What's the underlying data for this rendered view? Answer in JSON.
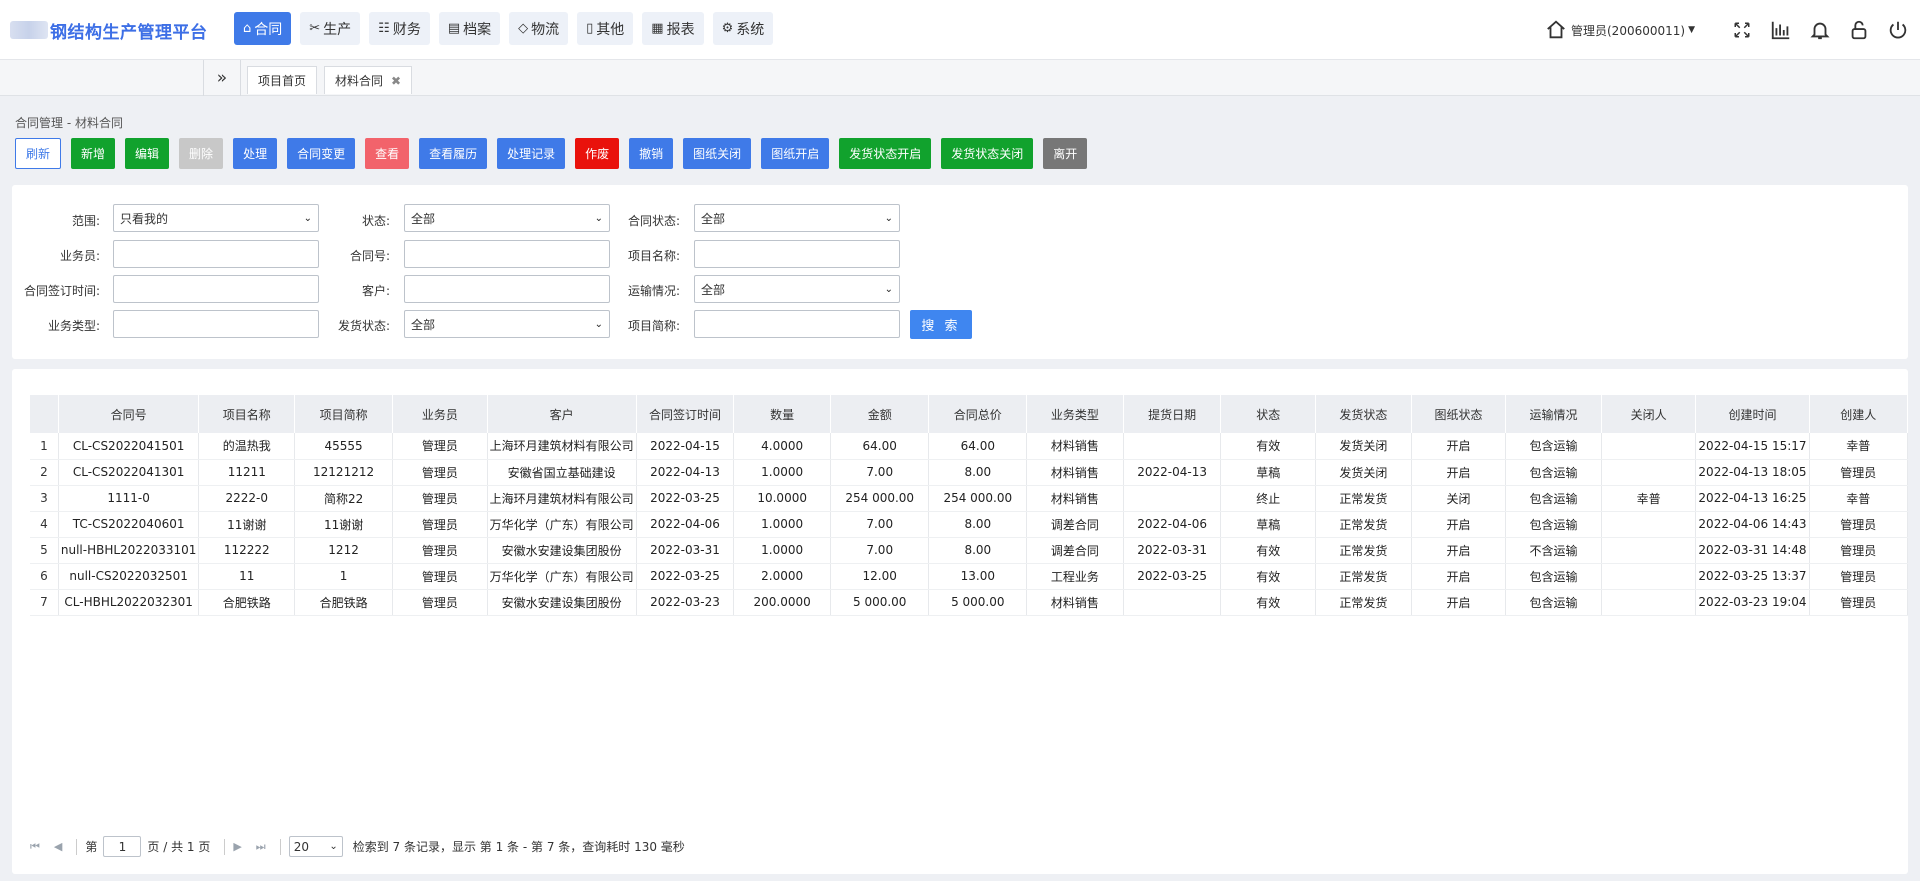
{
  "header": {
    "app_title": "钢结构生产管理平台",
    "nav": [
      {
        "label": "合同",
        "icon": "home-icon",
        "active": true
      },
      {
        "label": "生产",
        "icon": "scissors-icon",
        "active": false
      },
      {
        "label": "财务",
        "icon": "list-check-icon",
        "active": false
      },
      {
        "label": "档案",
        "icon": "archive-icon",
        "active": false
      },
      {
        "label": "物流",
        "icon": "tag-icon",
        "active": false
      },
      {
        "label": "其他",
        "icon": "document-icon",
        "active": false
      },
      {
        "label": "报表",
        "icon": "grid-icon",
        "active": false
      },
      {
        "label": "系统",
        "icon": "gear-icon",
        "active": false
      }
    ],
    "user": "管理员(200600011)"
  },
  "tabs": {
    "items": [
      {
        "label": "项目首页",
        "closable": false
      },
      {
        "label": "材料合同",
        "closable": true
      }
    ]
  },
  "breadcrumb": "合同管理 - 材料合同",
  "toolbar": {
    "refresh": "刷新",
    "add": "新增",
    "edit": "编辑",
    "delete": "删除",
    "process": "处理",
    "change": "合同变更",
    "view": "查看",
    "view_history": "查看履历",
    "process_log": "处理记录",
    "void": "作废",
    "revoke": "撤销",
    "drawing_close": "图纸关闭",
    "drawing_open": "图纸开启",
    "ship_open": "发货状态开启",
    "ship_close": "发货状态关闭",
    "leave": "离开"
  },
  "filters": {
    "scope_label": "范围:",
    "scope_value": "只看我的",
    "status_label": "状态:",
    "status_value": "全部",
    "contract_status_label": "合同状态:",
    "contract_status_value": "全部",
    "salesman_label": "业务员:",
    "salesman_value": "",
    "contract_no_label": "合同号:",
    "contract_no_value": "",
    "project_name_label": "项目名称:",
    "project_name_value": "",
    "sign_time_label": "合同签订时间:",
    "sign_time_value": "",
    "customer_label": "客户:",
    "customer_value": "",
    "transport_label": "运输情况:",
    "transport_value": "全部",
    "biz_type_label": "业务类型:",
    "biz_type_value": "",
    "ship_status_label": "发货状态:",
    "ship_status_value": "全部",
    "project_short_label": "项目简称:",
    "project_short_value": "",
    "search_button": "搜 索"
  },
  "grid": {
    "columns": [
      "合同号",
      "项目名称",
      "项目简称",
      "业务员",
      "客户",
      "合同签订时间",
      "数量",
      "金额",
      "合同总价",
      "业务类型",
      "提货日期",
      "状态",
      "发货状态",
      "图纸状态",
      "运输情况",
      "关闭人",
      "创建时间",
      "创建人"
    ],
    "rows": [
      [
        "1",
        "CL-CS2022041501",
        "的温热我",
        "45555",
        "管理员",
        "上海环月建筑材料有限公司",
        "2022-04-15",
        "4.0000",
        "64.00",
        "64.00",
        "材料销售",
        "",
        "有效",
        "发货关闭",
        "开启",
        "包含运输",
        "",
        "2022-04-15 15:17",
        "幸普"
      ],
      [
        "2",
        "CL-CS2022041301",
        "11211",
        "12121212",
        "管理员",
        "安徽省国立基础建设",
        "2022-04-13",
        "1.0000",
        "7.00",
        "8.00",
        "材料销售",
        "2022-04-13",
        "草稿",
        "发货关闭",
        "开启",
        "包含运输",
        "",
        "2022-04-13 18:05",
        "管理员"
      ],
      [
        "3",
        "1111-0",
        "2222-0",
        "简称22",
        "管理员",
        "上海环月建筑材料有限公司",
        "2022-03-25",
        "10.0000",
        "254 000.00",
        "254 000.00",
        "材料销售",
        "",
        "终止",
        "正常发货",
        "关闭",
        "包含运输",
        "幸普",
        "2022-04-13 16:25",
        "幸普"
      ],
      [
        "4",
        "TC-CS2022040601",
        "11谢谢",
        "11谢谢",
        "管理员",
        "万华化学（广东）有限公司",
        "2022-04-06",
        "1.0000",
        "7.00",
        "8.00",
        "调差合同",
        "2022-04-06",
        "草稿",
        "正常发货",
        "开启",
        "包含运输",
        "",
        "2022-04-06 14:43",
        "管理员"
      ],
      [
        "5",
        "null-HBHL2022033101",
        "112222",
        "1212",
        "管理员",
        "安徽水安建设集团股份",
        "2022-03-31",
        "1.0000",
        "7.00",
        "8.00",
        "调差合同",
        "2022-03-31",
        "有效",
        "正常发货",
        "开启",
        "不含运输",
        "",
        "2022-03-31 14:48",
        "管理员"
      ],
      [
        "6",
        "null-CS2022032501",
        "11",
        "1",
        "管理员",
        "万华化学（广东）有限公司",
        "2022-03-25",
        "2.0000",
        "12.00",
        "13.00",
        "工程业务",
        "2022-03-25",
        "有效",
        "正常发货",
        "开启",
        "包含运输",
        "",
        "2022-03-25 13:37",
        "管理员"
      ],
      [
        "7",
        "CL-HBHL2022032301",
        "合肥铁路",
        "合肥铁路",
        "管理员",
        "安徽水安建设集团股份",
        "2022-03-23",
        "200.0000",
        "5 000.00",
        "5 000.00",
        "材料销售",
        "",
        "有效",
        "正常发货",
        "开启",
        "包含运输",
        "",
        "2022-03-23 19:04",
        "管理员"
      ]
    ]
  },
  "pager": {
    "page_prefix": "第",
    "page_value": "1",
    "page_suffix": "页 / 共 1 页",
    "page_size": "20",
    "summary": "检索到 7 条记录，显示 第 1 条 - 第 7 条，查询耗时 130 毫秒"
  },
  "colors": {
    "primary": "#3f7ae8",
    "green": "#11a22d",
    "red": "#e9120c",
    "pink": "#f2636b"
  }
}
